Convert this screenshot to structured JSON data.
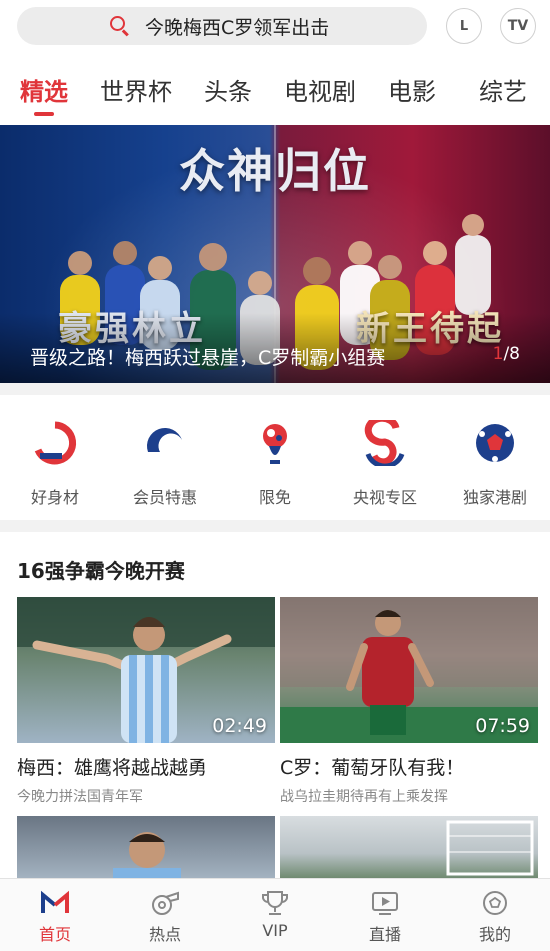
{
  "search": {
    "query": "今晚梅西C罗领军出击",
    "history_btn": "L",
    "tv_btn": "TV"
  },
  "tabs": [
    {
      "label": "精选",
      "active": true
    },
    {
      "label": "世界杯"
    },
    {
      "label": "头条"
    },
    {
      "label": "电视剧"
    },
    {
      "label": "电影"
    },
    {
      "label": "综艺"
    }
  ],
  "banner": {
    "headline": "众神归位",
    "slogan_left": "豪强林立",
    "slogan_right": "新王待起",
    "caption": "晋级之路！梅西跃过悬崖，C罗制霸小组赛",
    "current": "1",
    "total": "/8"
  },
  "shortcuts": [
    {
      "label": "好身材",
      "icon": "fitness-logo-icon"
    },
    {
      "label": "会员特惠",
      "icon": "vip-offer-icon"
    },
    {
      "label": "限免",
      "icon": "worldcup-trophy-icon"
    },
    {
      "label": "央视专区",
      "icon": "cctv-logo-icon"
    },
    {
      "label": "独家港剧",
      "icon": "soccer-ball-icon"
    }
  ],
  "section": {
    "title": "16强争霸今晚开赛",
    "cards": [
      {
        "title": "梅西：雄鹰将越战越勇",
        "subtitle": "今晚力拼法国青年军",
        "duration": "02:49"
      },
      {
        "title": "C罗：葡萄牙队有我！",
        "subtitle": "战乌拉圭期待再有上乘发挥",
        "duration": "07:59"
      }
    ]
  },
  "bottom_nav": [
    {
      "label": "首页",
      "icon": "home-logo-icon",
      "active": true
    },
    {
      "label": "热点",
      "icon": "whistle-icon"
    },
    {
      "label": "VIP",
      "icon": "trophy-icon"
    },
    {
      "label": "直播",
      "icon": "live-tv-icon"
    },
    {
      "label": "我的",
      "icon": "profile-ball-icon"
    }
  ],
  "colors": {
    "accent": "#e0353a",
    "navy": "#1d3f8c"
  }
}
